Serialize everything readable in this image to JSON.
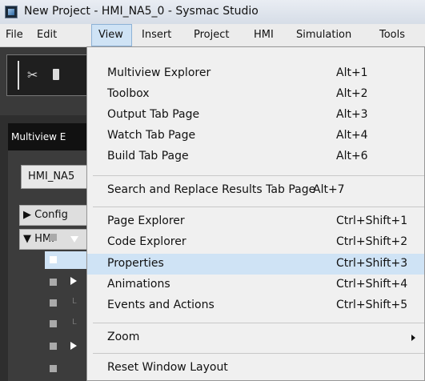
{
  "window": {
    "title": "New Project - HMI_NA5_0 - Sysmac Studio"
  },
  "menubar": [
    {
      "label": "File"
    },
    {
      "label": "Edit"
    },
    {
      "label": "View"
    },
    {
      "label": "Insert"
    },
    {
      "label": "Project"
    },
    {
      "label": "HMI"
    },
    {
      "label": "Simulation"
    },
    {
      "label": "Tools"
    }
  ],
  "background": {
    "panel_title": "Multiview E",
    "device": "HMI_NA5",
    "tree": [
      {
        "label": "▶ Config"
      },
      {
        "label": "▼ HMI"
      }
    ]
  },
  "view_menu": {
    "items": [
      {
        "label": "Multiview Explorer",
        "shortcut": "Alt+1"
      },
      {
        "label": "Toolbox",
        "shortcut": "Alt+2"
      },
      {
        "label": "Output Tab Page",
        "shortcut": "Alt+3"
      },
      {
        "label": "Watch Tab Page",
        "shortcut": "Alt+4"
      },
      {
        "label": "Build Tab Page",
        "shortcut": "Alt+6"
      },
      {
        "label": "Search and Replace Results Tab Page",
        "shortcut": "Alt+7"
      },
      {
        "label": "Page Explorer",
        "shortcut": "Ctrl+Shift+1"
      },
      {
        "label": "Code Explorer",
        "shortcut": "Ctrl+Shift+2"
      },
      {
        "label": "Properties",
        "shortcut": "Ctrl+Shift+3",
        "highlighted": true
      },
      {
        "label": "Animations",
        "shortcut": "Ctrl+Shift+4"
      },
      {
        "label": "Events and Actions",
        "shortcut": "Ctrl+Shift+5"
      },
      {
        "label": "Zoom",
        "shortcut": "",
        "submenu": true
      },
      {
        "label": "Reset Window Layout",
        "shortcut": ""
      }
    ]
  }
}
